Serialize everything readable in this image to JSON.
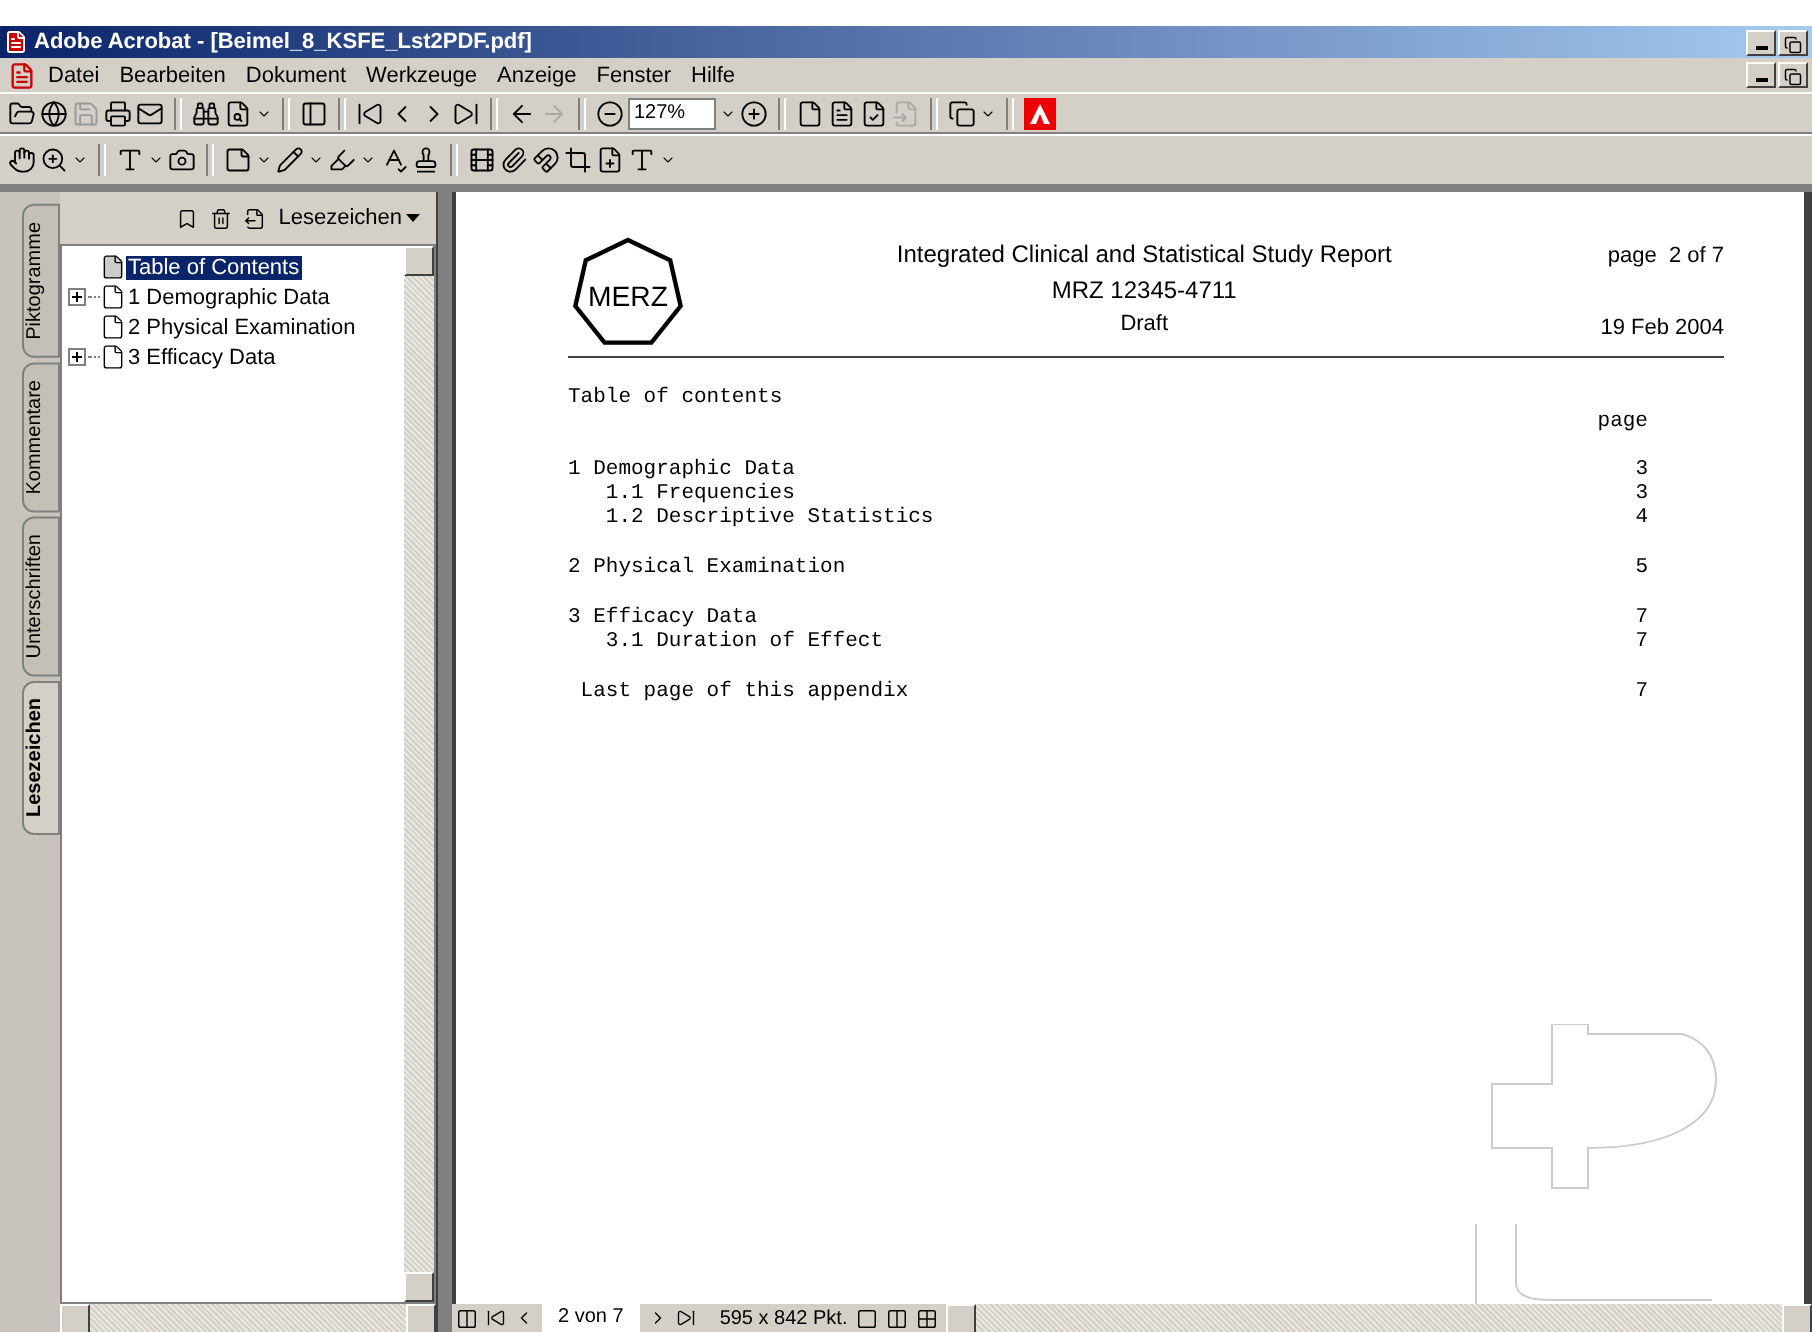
{
  "window": {
    "title": "Adobe Acrobat - [Beimel_8_KSFE_Lst2PDF.pdf]"
  },
  "menu": [
    "Datei",
    "Bearbeiten",
    "Dokument",
    "Werkzeuge",
    "Anzeige",
    "Fenster",
    "Hilfe"
  ],
  "toolbar": {
    "zoom": "127%"
  },
  "side_tabs": [
    {
      "label": "Piktogramme",
      "selected": false
    },
    {
      "label": "Kommentare",
      "selected": false
    },
    {
      "label": "Unterschriften",
      "selected": false
    },
    {
      "label": "Lesezeichen",
      "selected": true
    }
  ],
  "bookmarks_panel": {
    "menu_label": "Lesezeichen",
    "items": [
      {
        "label": "Table of Contents",
        "kind": "leaf",
        "selected": true
      },
      {
        "label": "1 Demographic Data",
        "kind": "collapsed",
        "selected": false
      },
      {
        "label": "2 Physical Examination",
        "kind": "leaf",
        "selected": false
      },
      {
        "label": "3 Efficacy Data",
        "kind": "collapsed",
        "selected": false
      }
    ]
  },
  "document": {
    "logo": "MERZ",
    "title": "Integrated Clinical and Statistical Study Report",
    "study": "MRZ 12345-4711",
    "status": "Draft",
    "page_info": "page  2 of 7",
    "date": "19 Feb 2004",
    "toc_heading": "Table of contents",
    "page_heading": "page",
    "toc": [
      {
        "kind": "section",
        "title": "1 Demographic Data",
        "page": "3",
        "children": [
          {
            "title": "1.1 Frequencies",
            "page": "3"
          },
          {
            "title": "1.2 Descriptive Statistics",
            "page": "4"
          }
        ]
      },
      {
        "kind": "section",
        "title": "2 Physical Examination",
        "page": "5"
      },
      {
        "kind": "section",
        "title": "3 Efficacy Data",
        "page": "7",
        "children": [
          {
            "title": "3.1 Duration of Effect",
            "page": "7"
          }
        ]
      },
      {
        "kind": "closing",
        "title": "Last page of this appendix",
        "page": "7"
      }
    ]
  },
  "status_bar": {
    "page": "2 von 7",
    "size": "595 x 842 Pkt."
  }
}
